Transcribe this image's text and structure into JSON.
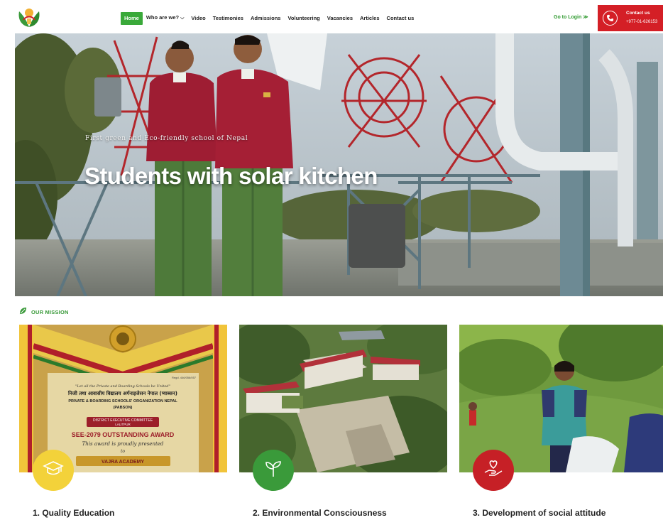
{
  "header": {
    "logo": "school-logo",
    "nav": [
      {
        "label": "Home",
        "active": true
      },
      {
        "label": "Who are we?",
        "dropdown": true
      },
      {
        "label": "Video"
      },
      {
        "label": "Testimonies"
      },
      {
        "label": "Admissions"
      },
      {
        "label": "Volunteering"
      },
      {
        "label": "Vacancies"
      },
      {
        "label": "Articles"
      },
      {
        "label": "Contact us"
      }
    ],
    "login": "Go to Login ≫",
    "contact": {
      "title": "Contact us",
      "phone": "+977-01-626153",
      "icon": "phone-icon"
    }
  },
  "hero": {
    "tagline": "First green and Eco-friendly school of Nepal",
    "title": "Students with solar kitchen"
  },
  "mission": {
    "label": "OUR MISSION",
    "icon": "leaf-icon",
    "cards": [
      {
        "title": "1. Quality Education",
        "icon": "graduation-cap-icon",
        "badge_color": "#f3d23a",
        "plaque": {
          "motto": "\"Let all the Private and Boarding Schools be United\"",
          "nepali": "निजी तथा आवासीय विद्यालय अर्गनाइजेसन नेपाल (प्याब्सन)",
          "org": "PRIVATE & BOARDING SCHOOLS' ORGANIZATION NEPAL",
          "org_short": "(PABSON)",
          "committee": "DISTRICT EXECUTIVE COMMITTEE",
          "district": "LALITPUR",
          "award": "SEE-2079 OUTSTANDING AWARD",
          "presented": "This award is proudly presented",
          "to": "to",
          "recipient": "VAJRA ACADEMY",
          "regd": "Regd. 446/056/057"
        }
      },
      {
        "title": "2. Environmental Consciousness",
        "icon": "sprout-icon",
        "badge_color": "#3a9a3a"
      },
      {
        "title": "3. Development of social attitude",
        "icon": "heart-hand-icon",
        "badge_color": "#c62026"
      }
    ]
  }
}
